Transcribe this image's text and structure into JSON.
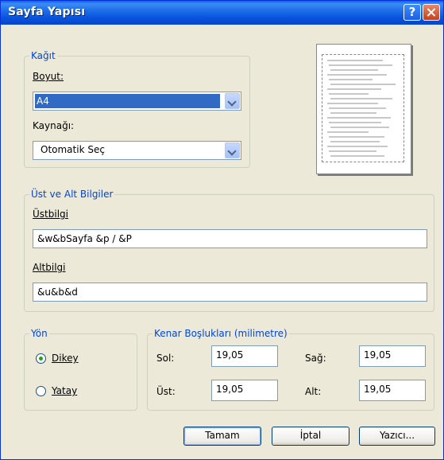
{
  "window": {
    "title": "Sayfa Yapısı",
    "help_glyph": "?"
  },
  "paper": {
    "group_label": "Kağıt",
    "size_label": "Boyut:",
    "size_value": "A4",
    "source_label": "Kaynağı:",
    "source_value": "Otomatik Seç"
  },
  "headers": {
    "group_label": "Üst ve Alt Bilgiler",
    "header_label": "Üstbilgi",
    "header_value": "&w&bSayfa &p / &P",
    "footer_label": "Altbilgi",
    "footer_value": "&u&b&d"
  },
  "orientation": {
    "group_label": "Yön",
    "portrait_label": "Dikey",
    "landscape_label": "Yatay",
    "selected": "portrait"
  },
  "margins": {
    "group_label": "Kenar Boşlukları (milimetre)",
    "left_label": "Sol:",
    "left_value": "19,05",
    "right_label": "Sağ:",
    "right_value": "19,05",
    "top_label": "Üst:",
    "top_value": "19,05",
    "bottom_label": "Alt:",
    "bottom_value": "19,05"
  },
  "buttons": {
    "ok": "Tamam",
    "cancel": "İptal",
    "printer": "Yazıcı..."
  },
  "colors": {
    "title_bar": "#0A5FE8",
    "group_label": "#0046D5",
    "selection": "#316AC5",
    "dialog_bg": "#ECE9D8"
  }
}
